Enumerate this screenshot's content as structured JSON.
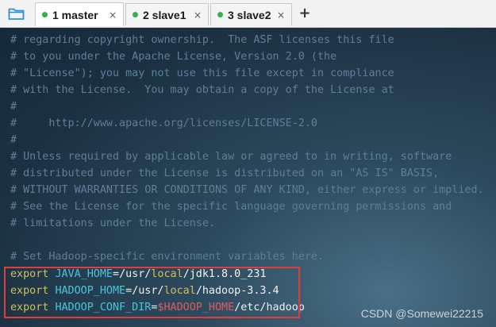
{
  "tabs": [
    {
      "label": "1 master",
      "active": true
    },
    {
      "label": "2 slave1",
      "active": false
    },
    {
      "label": "3 slave2",
      "active": false
    }
  ],
  "icons": {
    "folder": "folder-icon",
    "close": "close-icon",
    "add": "plus-icon"
  },
  "tab_close_glyph": "×",
  "add_tab_glyph": "+",
  "editor": {
    "comment_lines": [
      "# regarding copyright ownership.  The ASF licenses this file",
      "# to you under the Apache License, Version 2.0 (the",
      "# \"License\"); you may not use this file except in compliance",
      "# with the License.  You may obtain a copy of the License at",
      "#",
      "#     http://www.apache.org/licenses/LICENSE-2.0",
      "#",
      "# Unless required by applicable law or agreed to in writing, software",
      "# distributed under the License is distributed on an \"AS IS\" BASIS,",
      "# WITHOUT WARRANTIES OR CONDITIONS OF ANY KIND, either express or implied.",
      "# See the License for the specific language governing permissions and",
      "# limitations under the License.",
      "",
      "# Set Hadoop-specific environment variables here."
    ],
    "export_lines": [
      {
        "keyword": "export",
        "name": "JAVA_HOME",
        "eq": "=",
        "p1": "/usr/",
        "p2": "local",
        "p3": "/jdk1.8.0_231"
      },
      {
        "keyword": "export",
        "name": "HADOOP_HOME",
        "eq": "=",
        "p1": "/usr/",
        "p2": "local",
        "p3": "/hadoop-3.3.4"
      },
      {
        "keyword": "export",
        "name": "HADOOP_CONF_DIR",
        "eq": "=",
        "p1": "$HADOOP_HOME",
        "p2": "/etc/hadoop",
        "p3": ""
      }
    ]
  },
  "watermark": "CSDN @Somewei22215",
  "colors": {
    "comment": "#5f7f99",
    "keyword": "#d2c057",
    "variable": "#48c6d8",
    "dollar_var": "#e05a60",
    "highlight_border": "#e13d3d",
    "active_dot": "#2fb24a"
  }
}
